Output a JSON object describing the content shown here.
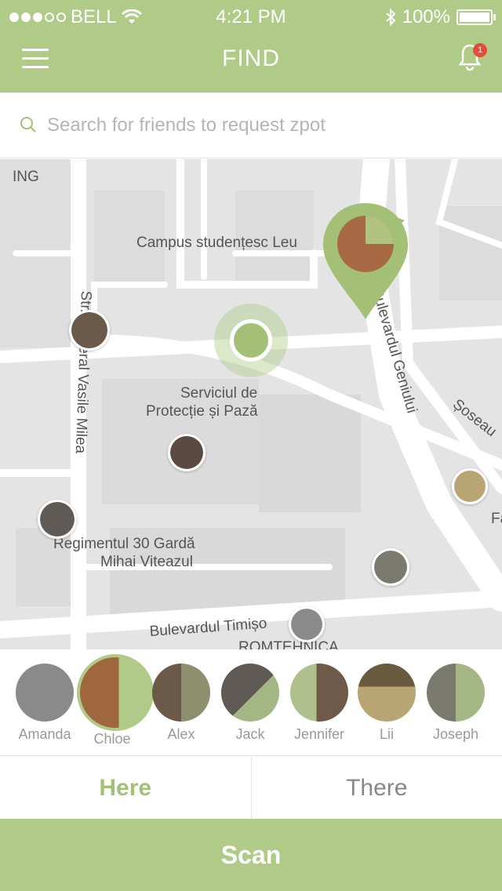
{
  "status": {
    "carrier": "BELL",
    "time": "4:21 PM",
    "battery": "100%"
  },
  "header": {
    "title": "FIND",
    "notifications": "1"
  },
  "search": {
    "placeholder": "Search for friends to request zpot"
  },
  "map": {
    "labels": {
      "ing": "ING",
      "campus": "Campus studențesc Leu",
      "street_left": "Str. General Vasile Milea",
      "serviciul_1": "Serviciul de",
      "serviciul_2": "Protecție și Pază",
      "regiment_1": "Regimentul 30 Gardă",
      "regiment_2": "Mihai Viteazul",
      "bulevard_bottom": "Bulevardul Timișo",
      "romtehnica": "ROMTEHNICA",
      "bulevard_geniului": "Bulevardul Geniului",
      "soseaua": "Șoseau",
      "fa": "Fa"
    }
  },
  "friends": [
    {
      "name": "Amanda",
      "color": "#8a8a8a"
    },
    {
      "name": "Chloe",
      "color": "#a0673f"
    },
    {
      "name": "Alex",
      "color": "#6b5a4a"
    },
    {
      "name": "Jack",
      "color": "#5f5a55"
    },
    {
      "name": "Jennifer",
      "color": "#6e5a49"
    },
    {
      "name": "Lii",
      "color": "#b9a574"
    },
    {
      "name": "Joseph",
      "color": "#7a7a6e"
    }
  ],
  "tabs": {
    "here": "Here",
    "there": "There"
  },
  "actions": {
    "scan": "Scan"
  },
  "colors": {
    "accent": "#b0cb87",
    "accent_dark": "#a3c076",
    "badge": "#e54c3c"
  }
}
